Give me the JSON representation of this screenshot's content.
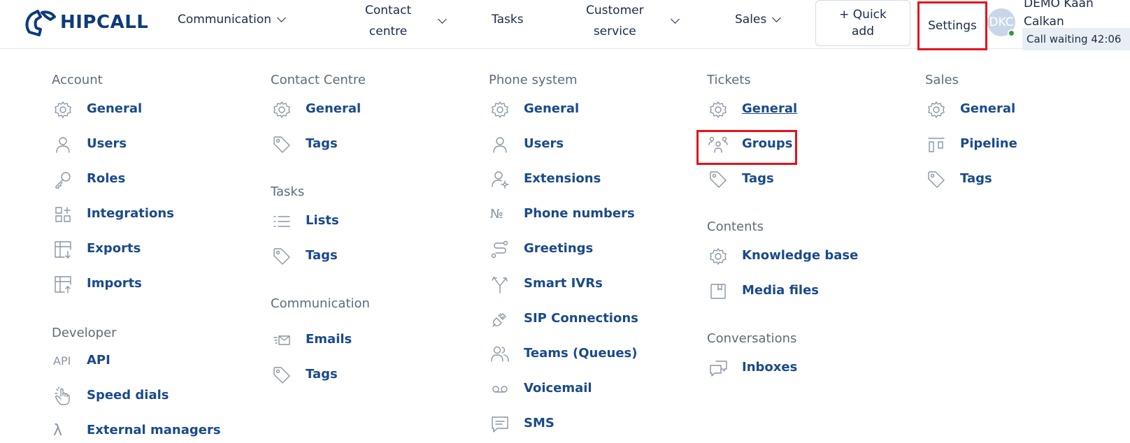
{
  "brand": {
    "name": "HIPCALL"
  },
  "nav": {
    "communication": "Communication",
    "contact_centre": [
      "Contact",
      "centre"
    ],
    "tasks": "Tasks",
    "customer_service": [
      "Customer",
      "service"
    ],
    "sales": "Sales",
    "quick_add": [
      "+ Quick",
      "add"
    ],
    "settings": "Settings"
  },
  "user": {
    "initials": "DKC",
    "name": [
      "DEMO Kaan",
      "Calkan"
    ],
    "status": "online",
    "call_waiting": "Call waiting 42:06"
  },
  "colors": {
    "accent": "#1a4a8a",
    "highlight": "#e3131b",
    "online": "#2e9b3d"
  },
  "menu": {
    "account": {
      "title": "Account",
      "items": [
        {
          "label": "General",
          "icon": "gear-icon"
        },
        {
          "label": "Users",
          "icon": "user-icon"
        },
        {
          "label": "Roles",
          "icon": "key-icon"
        },
        {
          "label": "Integrations",
          "icon": "integrations-icon"
        },
        {
          "label": "Exports",
          "icon": "export-icon"
        },
        {
          "label": "Imports",
          "icon": "import-icon"
        }
      ]
    },
    "developer": {
      "title": "Developer",
      "items": [
        {
          "label": "API",
          "icon": "api-icon",
          "icon_text": "API"
        },
        {
          "label": "Speed dials",
          "icon": "tap-icon"
        },
        {
          "label": "External managers",
          "icon": "lambda-icon",
          "icon_text": "λ"
        }
      ]
    },
    "contact_centre": {
      "title": "Contact Centre",
      "items": [
        {
          "label": "General",
          "icon": "gear-icon"
        },
        {
          "label": "Tags",
          "icon": "tag-icon"
        }
      ]
    },
    "tasks": {
      "title": "Tasks",
      "items": [
        {
          "label": "Lists",
          "icon": "list-icon"
        },
        {
          "label": "Tags",
          "icon": "tag-icon"
        }
      ]
    },
    "communication": {
      "title": "Communication",
      "items": [
        {
          "label": "Emails",
          "icon": "email-icon"
        },
        {
          "label": "Tags",
          "icon": "tag-icon"
        }
      ]
    },
    "phone_system": {
      "title": "Phone system",
      "items": [
        {
          "label": "General",
          "icon": "gear-icon"
        },
        {
          "label": "Users",
          "icon": "user-icon"
        },
        {
          "label": "Extensions",
          "icon": "user-gear-icon"
        },
        {
          "label": "Phone numbers",
          "icon": "numero-icon",
          "icon_text": "№"
        },
        {
          "label": "Greetings",
          "icon": "greeting-icon"
        },
        {
          "label": "Smart IVRs",
          "icon": "ivr-icon"
        },
        {
          "label": "SIP Connections",
          "icon": "plug-icon"
        },
        {
          "label": "Teams (Queues)",
          "icon": "team-icon"
        },
        {
          "label": "Voicemail",
          "icon": "voicemail-icon"
        },
        {
          "label": "SMS",
          "icon": "sms-icon"
        }
      ]
    },
    "tickets": {
      "title": "Tickets",
      "items": [
        {
          "label": "General",
          "icon": "gear-icon"
        },
        {
          "label": "Groups",
          "icon": "groups-icon"
        },
        {
          "label": "Tags",
          "icon": "tag-icon"
        }
      ]
    },
    "contents": {
      "title": "Contents",
      "items": [
        {
          "label": "Knowledge base",
          "icon": "gear-icon"
        },
        {
          "label": "Media files",
          "icon": "media-icon"
        }
      ]
    },
    "conversations": {
      "title": "Conversations",
      "items": [
        {
          "label": "Inboxes",
          "icon": "chat-icon"
        }
      ]
    },
    "sales": {
      "title": "Sales",
      "items": [
        {
          "label": "General",
          "icon": "gear-icon"
        },
        {
          "label": "Pipeline",
          "icon": "pipeline-icon"
        },
        {
          "label": "Tags",
          "icon": "tag-icon"
        }
      ]
    }
  }
}
